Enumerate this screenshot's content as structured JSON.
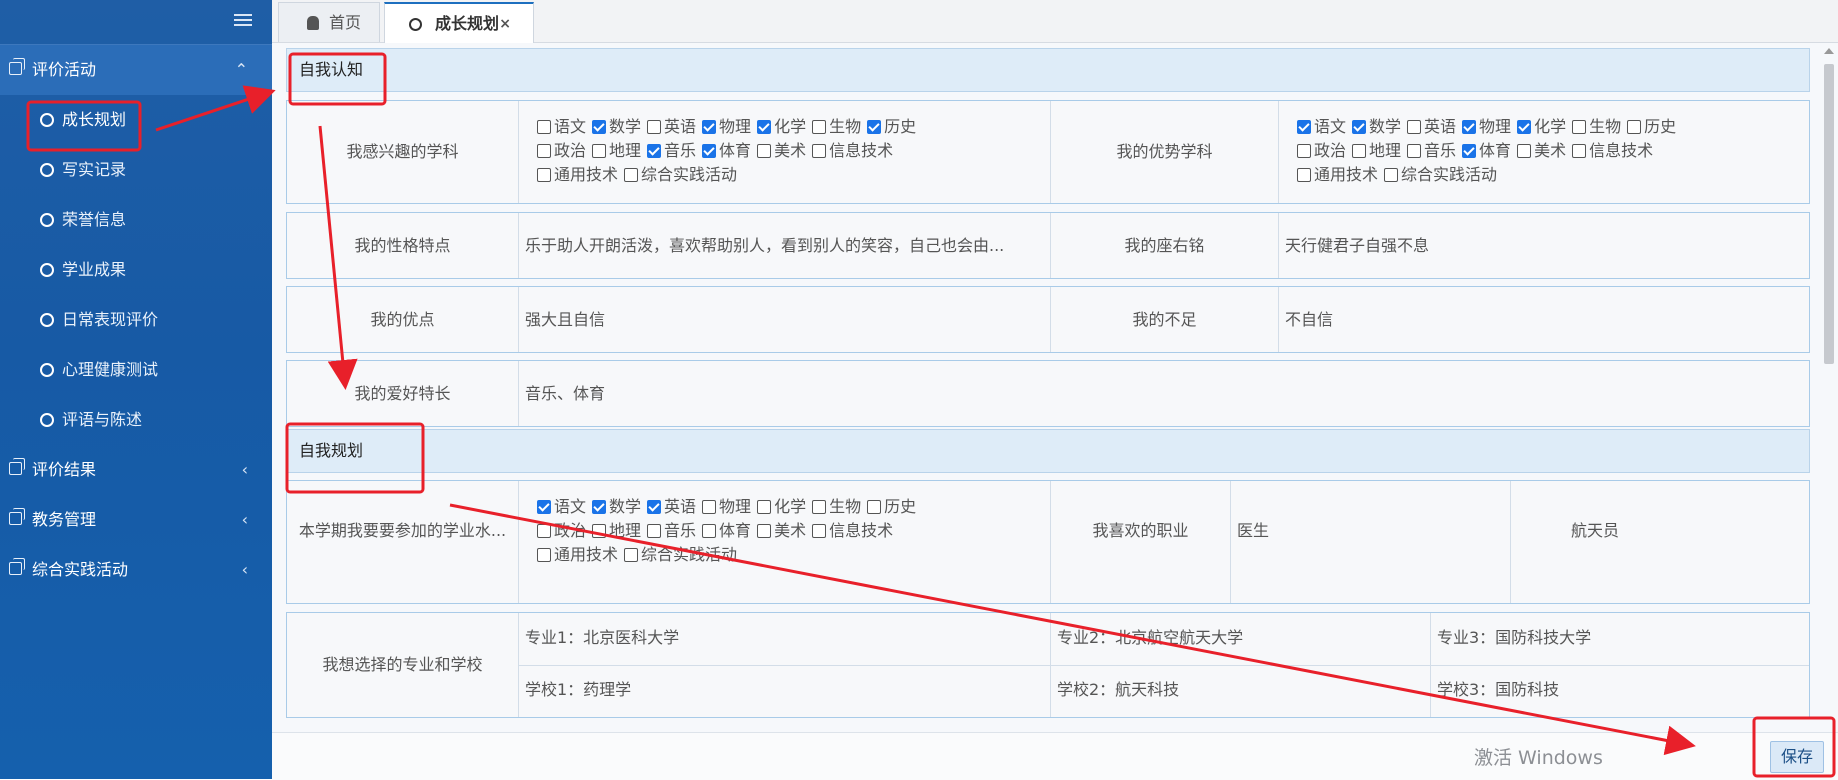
{
  "sidebar": {
    "groups": [
      {
        "label": "评价活动",
        "chevron": "⌃"
      },
      {
        "label": "评价结果",
        "chevron": "‹"
      },
      {
        "label": "教务管理",
        "chevron": "‹"
      },
      {
        "label": "综合实践活动",
        "chevron": "‹"
      }
    ],
    "sub_items": [
      "成长规划",
      "写实记录",
      "荣誉信息",
      "学业成果",
      "日常表现评价",
      "心理健康测试",
      "评语与陈述"
    ]
  },
  "tabs": {
    "home": "首页",
    "current": "成长规划",
    "close": "×"
  },
  "sections": {
    "self_awareness": "自我认知",
    "self_planning": "自我规划"
  },
  "subjects": [
    "语文",
    "数学",
    "英语",
    "物理",
    "化学",
    "生物",
    "历史",
    "政治",
    "地理",
    "音乐",
    "体育",
    "美术",
    "信息技术",
    "通用技术",
    "综合实践活动"
  ],
  "form": {
    "interested_label": "我感兴趣的学科",
    "interested_checked": [
      false,
      true,
      false,
      true,
      true,
      false,
      true,
      false,
      false,
      true,
      true,
      false,
      false,
      false,
      false
    ],
    "strong_label": "我的优势学科",
    "strong_checked": [
      true,
      true,
      false,
      true,
      true,
      false,
      false,
      false,
      false,
      false,
      true,
      false,
      false,
      false,
      false
    ],
    "personality_label": "我的性格特点",
    "personality_value": "乐于助人开朗活泼，喜欢帮助别人，看到别人的笑容，自己也会由...",
    "motto_label": "我的座右铭",
    "motto_value": "天行健君子自强不息",
    "merits_label": "我的优点",
    "merits_value": "强大且自信",
    "shortcomings_label": "我的不足",
    "shortcomings_value": "不自信",
    "hobbies_label": "我的爱好特长",
    "hobbies_value": "音乐、体育",
    "exam_label": "本学期我要要参加的学业水...",
    "exam_checked": [
      true,
      true,
      true,
      false,
      false,
      false,
      false,
      false,
      false,
      false,
      false,
      false,
      false,
      false,
      false
    ],
    "career_label": "我喜欢的职业",
    "career_value1": "医生",
    "career_value2": "航天员",
    "major_school_label": "我想选择的专业和学校",
    "majors": [
      "专业1：北京医科大学",
      "专业2：北京航空航天大学",
      "专业3：国防科技大学"
    ],
    "schools": [
      "学校1：药理学",
      "学校2：航天科技",
      "学校3：国防科技"
    ]
  },
  "footer": {
    "save": "保存",
    "watermark": "激活 Windows"
  },
  "colors": {
    "sidebar": "#1a5ea8",
    "annotation": "#e8202a",
    "accent": "#1a73e8"
  }
}
